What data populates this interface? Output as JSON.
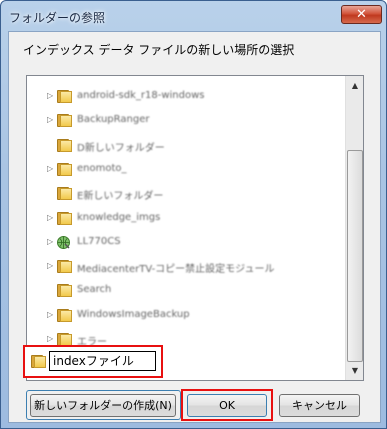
{
  "window": {
    "title": "フォルダーの参照",
    "close_symbol": "✕"
  },
  "instruction": "インデックス データ ファイルの新しい場所の選択",
  "tree": {
    "items": [
      {
        "label": "android-sdk_r18-windows",
        "icon": "folder-icon",
        "expander": "▷"
      },
      {
        "label": "BackupRanger",
        "icon": "folder-icon",
        "expander": "▷"
      },
      {
        "label": "D新しいフォルダー",
        "icon": "folder-icon",
        "expander": ""
      },
      {
        "label": "enomoto_",
        "icon": "folder-icon",
        "expander": "▷"
      },
      {
        "label": "E新しいフォルダー",
        "icon": "folder-icon",
        "expander": ""
      },
      {
        "label": "knowledge_imgs",
        "icon": "folder-icon",
        "expander": "▷"
      },
      {
        "label": "LL770CS",
        "icon": "globe-icon",
        "expander": "▷"
      },
      {
        "label": "MediacenterTV-コピー禁止設定モジュール",
        "icon": "folder-icon",
        "expander": "▷"
      },
      {
        "label": "Search",
        "icon": "folder-icon",
        "expander": ""
      },
      {
        "label": "WindowsImageBackup",
        "icon": "folder-icon",
        "expander": "▷"
      },
      {
        "label": "エラー",
        "icon": "folder-icon",
        "expander": "▷"
      }
    ],
    "rename_value": "indexファイル"
  },
  "scrollbar": {
    "up_arrow": "▲",
    "down_arrow": "▼"
  },
  "buttons": {
    "new_folder": "新しいフォルダーの作成(N)",
    "ok": "OK",
    "cancel": "キャンセル"
  }
}
